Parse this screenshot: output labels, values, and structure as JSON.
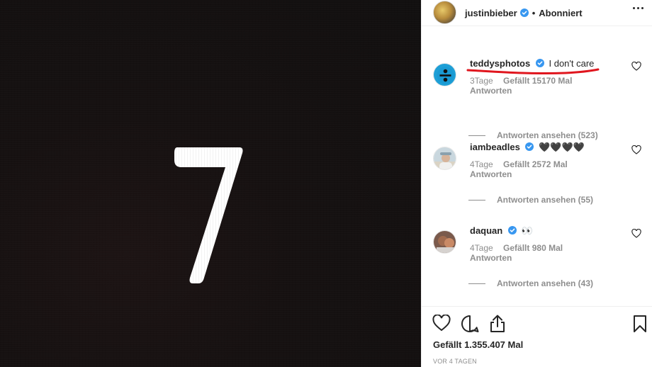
{
  "media": {
    "digit": "7"
  },
  "header": {
    "username": "justinbieber",
    "separator": "•",
    "follow_status": "Abonniert"
  },
  "comments": [
    {
      "username": "teddysphotos",
      "text": "I don't care",
      "age": "3Tage",
      "likes": "Gefällt 15170 Mal",
      "reply_label": "Antworten",
      "view_replies": "Antworten ansehen (523)",
      "highlighted": true
    },
    {
      "username": "iambeadles",
      "text": "🖤🖤🖤🖤",
      "age": "4Tage",
      "likes": "Gefällt 2572 Mal",
      "reply_label": "Antworten",
      "view_replies": "Antworten ansehen (55)"
    },
    {
      "username": "daquan",
      "text": "👀",
      "age": "4Tage",
      "likes": "Gefällt 980 Mal",
      "reply_label": "Antworten",
      "view_replies": "Antworten ansehen (43)"
    }
  ],
  "actions": {
    "icons": [
      "heart-icon",
      "comment-icon",
      "share-icon",
      "bookmark-icon"
    ],
    "likes_total": "Gefällt 1.355.407 Mal",
    "timestamp": "VOR 4 TAGEN"
  },
  "colors": {
    "accent_verified": "#3897f0",
    "annotation_red": "#e0161e",
    "muted_text": "#8e8e8e",
    "media_bg": "#141010"
  }
}
